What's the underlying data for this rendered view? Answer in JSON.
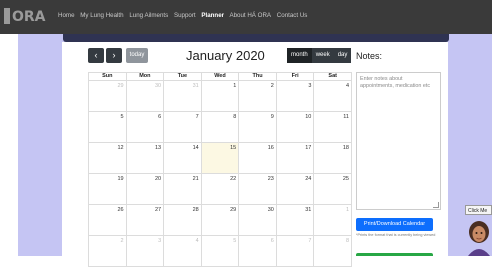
{
  "nav": {
    "logo_text": "ORA",
    "links": [
      "Home",
      "My Lung Health",
      "Lung Ailments",
      "Support",
      "Planner",
      "About HÁ ORA",
      "Contact Us"
    ],
    "active_index": 4
  },
  "toolbar": {
    "prev_glyph": "‹",
    "next_glyph": "›",
    "today_label": "today",
    "title": "January 2020",
    "views": [
      "month",
      "week",
      "day"
    ],
    "active_view": "month"
  },
  "calendar": {
    "weekdays": [
      "Sun",
      "Mon",
      "Tue",
      "Wed",
      "Thu",
      "Fri",
      "Sat"
    ],
    "weeks": [
      [
        "29",
        "30",
        "31",
        "1",
        "2",
        "3",
        "4"
      ],
      [
        "5",
        "6",
        "7",
        "8",
        "9",
        "10",
        "11"
      ],
      [
        "12",
        "13",
        "14",
        "15",
        "16",
        "17",
        "18"
      ],
      [
        "19",
        "20",
        "21",
        "22",
        "23",
        "24",
        "25"
      ],
      [
        "26",
        "27",
        "28",
        "29",
        "30",
        "31",
        "1"
      ],
      [
        "2",
        "3",
        "4",
        "5",
        "6",
        "7",
        "8"
      ]
    ],
    "today": "15"
  },
  "notes": {
    "label": "Notes:",
    "placeholder": "Enter notes about appointments, medication etc",
    "print_label": "Print/Download Calendar",
    "print_note": "*Prints the format that is currently being viewed"
  },
  "chat": {
    "label": "Click Me"
  },
  "colors": {
    "navbar": "#3a3a3a",
    "backdrop": "#c5c5f3",
    "accent": "#0d6efd",
    "today_bg": "#fcf8e3"
  }
}
